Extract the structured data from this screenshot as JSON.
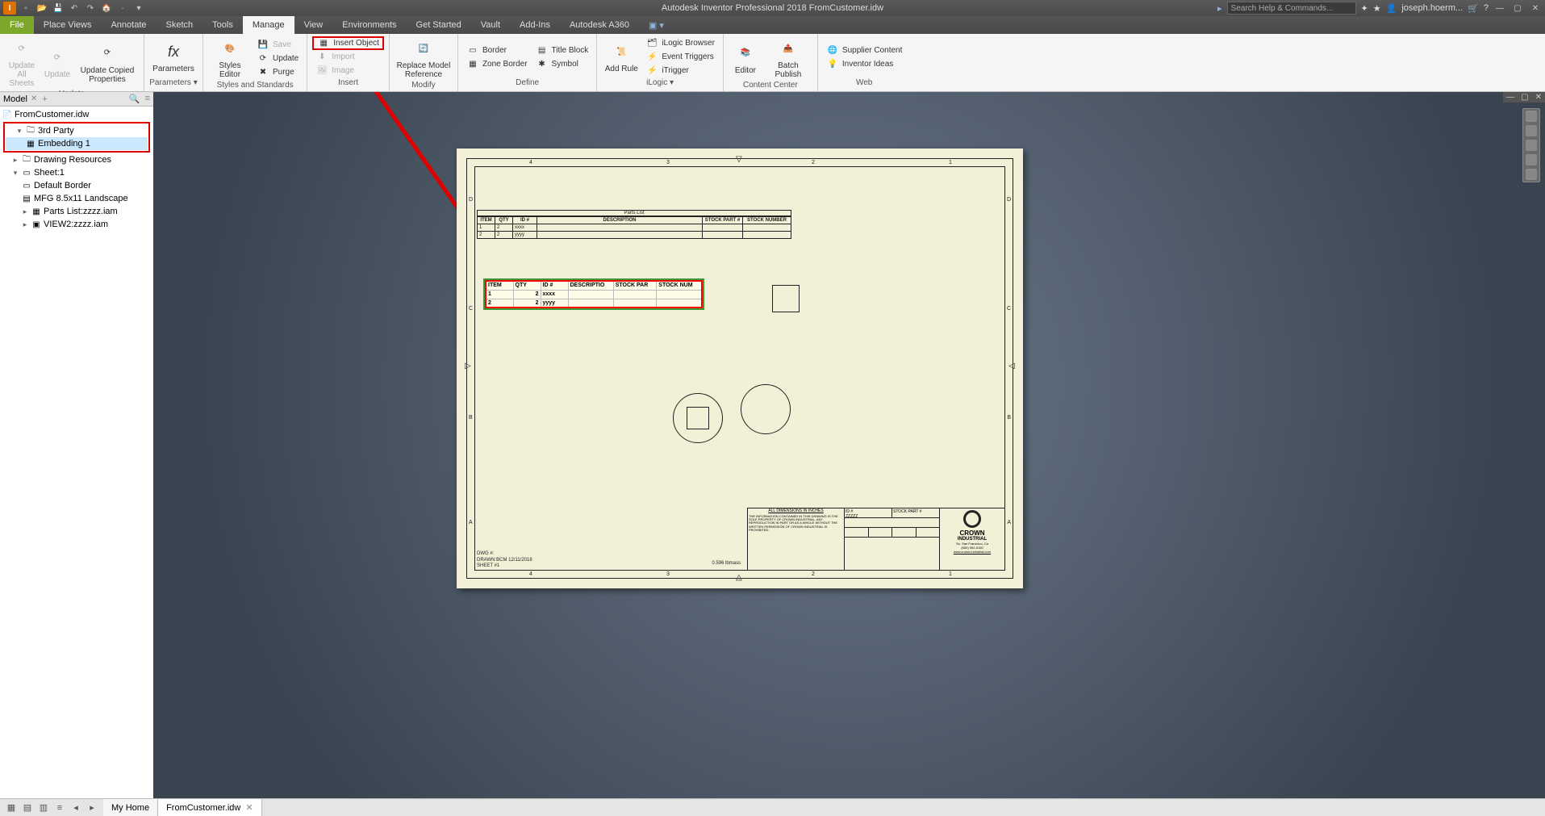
{
  "title": "Autodesk Inventor Professional 2018   FromCustomer.idw",
  "search_placeholder": "Search Help & Commands...",
  "user": "joseph.hoerm...",
  "menu": {
    "file": "File",
    "tabs": [
      "Place Views",
      "Annotate",
      "Sketch",
      "Tools",
      "Manage",
      "View",
      "Environments",
      "Get Started",
      "Vault",
      "Add-Ins",
      "Autodesk A360"
    ],
    "active": "Manage"
  },
  "ribbon": {
    "update": {
      "btn1": "Update",
      "btn2": "Update",
      "btn3": "Update Copied Properties",
      "sub1": "All Sheets",
      "group": "Update"
    },
    "parameters": {
      "btn": "Parameters",
      "group": "Parameters ▾"
    },
    "styles": {
      "btn": "Styles Editor",
      "save": "Save",
      "update": "Update",
      "purge": "Purge",
      "group": "Styles and Standards"
    },
    "insert": {
      "obj": "Insert Object",
      "import": "Import",
      "image": "Image",
      "group": "Insert"
    },
    "modify": {
      "btn": "Replace Model Reference",
      "group": "Modify"
    },
    "define": {
      "border": "Border",
      "zone": "Zone Border",
      "title": "Title Block",
      "symbol": "Symbol",
      "group": "Define"
    },
    "ilogic": {
      "addrule": "Add Rule",
      "browser": "iLogic Browser",
      "triggers": "Event Triggers",
      "itrigger": "iTrigger",
      "group": "iLogic ▾"
    },
    "content": {
      "editor": "Editor",
      "batch": "Batch Publish",
      "group": "Content Center"
    },
    "web": {
      "supplier": "Supplier Content",
      "ideas": "Inventor Ideas",
      "group": "Web"
    }
  },
  "browser": {
    "title": "Model",
    "root": "FromCustomer.idw",
    "thirdparty": "3rd Party",
    "embedding": "Embedding 1",
    "resources": "Drawing Resources",
    "sheet": "Sheet:1",
    "items": [
      "Default Border",
      "MFG 8.5x11 Landscape",
      "Parts List:zzzz.iam",
      "VIEW2:zzzz.iam"
    ]
  },
  "partslist": {
    "title": "Parts List",
    "headers": [
      "ITEM",
      "QTY",
      "ID #",
      "DESCRIPTION",
      "STOCK PART #",
      "STOCK NUMBER"
    ],
    "rows": [
      [
        "1",
        "2",
        "xxxx",
        "",
        "",
        ""
      ],
      [
        "2",
        "2",
        "yyyy",
        "",
        "",
        ""
      ]
    ]
  },
  "ole": {
    "headers": [
      "ITEM",
      "QTY",
      "ID #",
      "DESCRIPTIO",
      "STOCK PAR",
      "STOCK NUM"
    ],
    "rows": [
      [
        "1",
        "2",
        "xxxx",
        "",
        "",
        ""
      ],
      [
        "2",
        "2",
        "yyyy",
        "",
        "",
        ""
      ]
    ]
  },
  "titleblock": {
    "dim": "ALL DIMENSIONS IN INCHES",
    "note": "THE INFORMATION CONTAINED IN THIS DRAWING IS THE SOLE PROPERTY OF CROWN INDUSTRIAL. ANY REPRODUCTION IN PART OR AS A WHOLE WITHOUT THE WRITTEN PERMISSION OF CROWN INDUSTRIAL IS PROHIBITED.",
    "id": "ID #",
    "stockpart": "STOCK PART #",
    "zzzz": "ZZZZZ",
    "company": "CROWN",
    "company2": "INDUSTRIAL",
    "loc": "So. San Francisco, Ca",
    "phone": "(650) 952-5150",
    "web": "www.crown-industrial.com"
  },
  "dwginfo": {
    "l1": "DWG #:",
    "l2": "DRAWN:BCM  12/11/2018",
    "l3": "SHEET #1"
  },
  "mass": "0.596 lbmass",
  "bottom": {
    "home": "My Home",
    "doc": "FromCustomer.idw"
  }
}
